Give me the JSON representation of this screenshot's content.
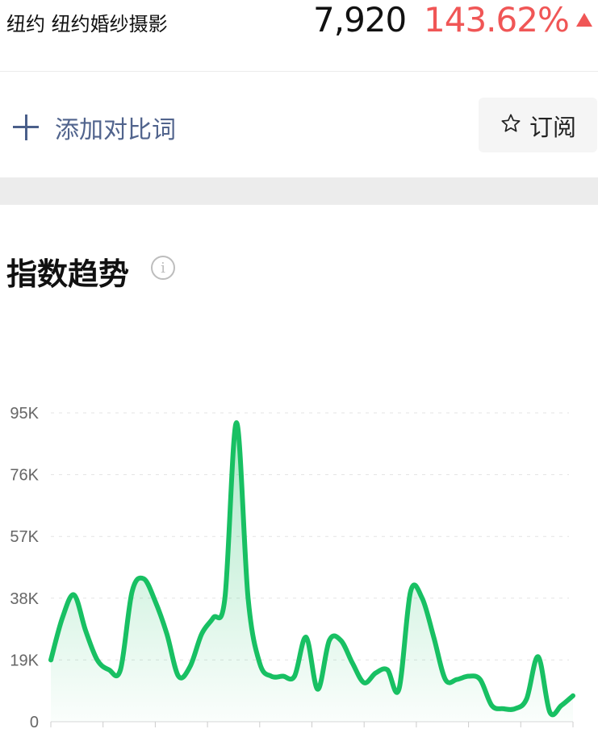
{
  "header": {
    "keyword": "纽约 纽约婚纱摄影",
    "index_value": "7,920",
    "change_value": "143.62%",
    "change_color": "#f05656",
    "change_direction_icon": "up-triangle-icon"
  },
  "compare": {
    "add_label": "添加对比词",
    "add_icon": "plus-icon",
    "subscribe_label": "订阅",
    "subscribe_icon": "star-icon"
  },
  "section": {
    "title": "指数趋势",
    "info_icon": "info-icon",
    "info_glyph": "i"
  },
  "chart_data": {
    "type": "area",
    "title": "",
    "xlabel": "",
    "ylabel": "",
    "ylim": [
      0,
      95000
    ],
    "yticks": [
      "0",
      "19K",
      "38K",
      "57K",
      "76K",
      "95K"
    ],
    "grid": true,
    "line_color": "#18c063",
    "x_label_count": 11,
    "series": [
      {
        "values": [
          19000,
          32000,
          39000,
          28000,
          19000,
          16000,
          16000,
          40000,
          44000,
          37000,
          27000,
          14000,
          17000,
          27000,
          32000,
          38000,
          92000,
          38000,
          18000,
          14000,
          14000,
          14000,
          26000,
          10000,
          25000,
          25000,
          18000,
          12000,
          15000,
          16000,
          10000,
          40000,
          38000,
          26000,
          13000,
          13000,
          14000,
          13000,
          5000,
          4000,
          4000,
          7000,
          20000,
          3000,
          5000,
          8000
        ]
      }
    ]
  }
}
